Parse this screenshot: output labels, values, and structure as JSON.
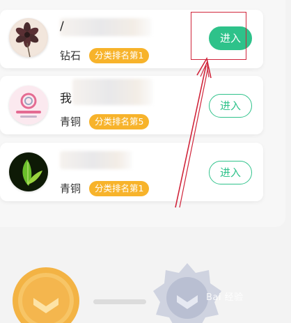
{
  "cards": [
    {
      "name_initial": "/",
      "tier": "钻石",
      "rank_badge": "分类排名第1",
      "enter_label": "进入",
      "active": true
    },
    {
      "name_initial": "我",
      "tier": "青铜",
      "rank_badge": "分类排名第5",
      "enter_label": "进入",
      "active": false
    },
    {
      "name_initial": "",
      "tier": "青铜",
      "rank_badge": "分类排名第1",
      "enter_label": "进入",
      "active": false
    }
  ],
  "watermark": "Bai 经验",
  "colors": {
    "accent_green": "#2ec28a",
    "badge_orange": "#f7b32b",
    "annotation_red": "#d0243a"
  },
  "icons": [
    "flower-avatar-icon",
    "circle-logo-avatar-icon",
    "leaf-avatar-icon",
    "gold-medal-icon",
    "silver-medal-icon"
  ]
}
